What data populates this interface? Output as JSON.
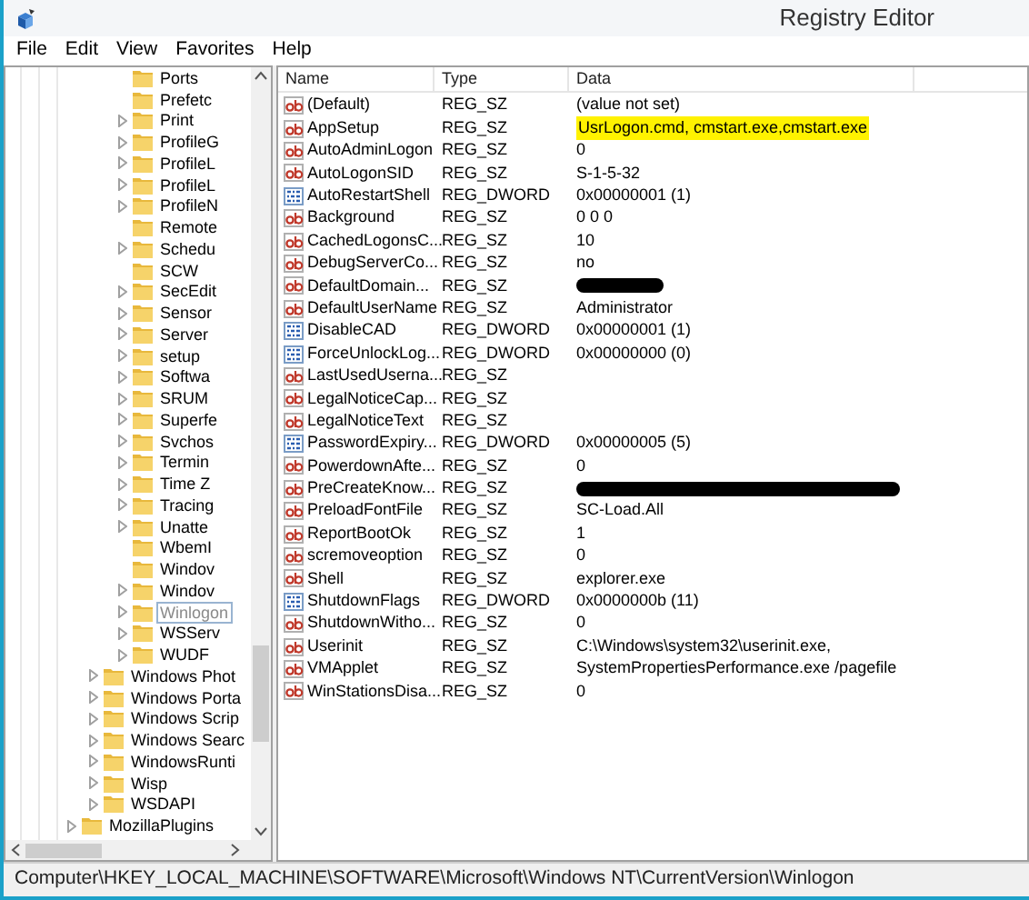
{
  "window": {
    "title": "Registry Editor"
  },
  "menu": [
    "File",
    "Edit",
    "View",
    "Favorites",
    "Help"
  ],
  "tree": {
    "items": [
      {
        "children": [
          {
            "children": [
              {
                "label": "Ports",
                "expandable": false,
                "selected": false
              },
              {
                "label": "Prefetc",
                "expandable": false,
                "selected": false
              },
              {
                "label": "Print",
                "expandable": true,
                "selected": false
              },
              {
                "label": "ProfileG",
                "expandable": true,
                "selected": false
              },
              {
                "label": "ProfileL",
                "expandable": true,
                "selected": false
              },
              {
                "label": "ProfileL",
                "expandable": true,
                "selected": false
              },
              {
                "label": "ProfileN",
                "expandable": true,
                "selected": false
              },
              {
                "label": "Remote",
                "expandable": false,
                "selected": false
              },
              {
                "label": "Schedu",
                "expandable": true,
                "selected": false
              },
              {
                "label": "SCW",
                "expandable": false,
                "selected": false
              },
              {
                "label": "SecEdit",
                "expandable": true,
                "selected": false
              },
              {
                "label": "Sensor",
                "expandable": true,
                "selected": false
              },
              {
                "label": "Server",
                "expandable": true,
                "selected": false
              },
              {
                "label": "setup",
                "expandable": true,
                "selected": false
              },
              {
                "label": "Softwa",
                "expandable": true,
                "selected": false
              },
              {
                "label": "SRUM",
                "expandable": true,
                "selected": false
              },
              {
                "label": "Superfe",
                "expandable": true,
                "selected": false
              },
              {
                "label": "Svchos",
                "expandable": true,
                "selected": false
              },
              {
                "label": "Termin",
                "expandable": true,
                "selected": false
              },
              {
                "label": "Time Z",
                "expandable": true,
                "selected": false
              },
              {
                "label": "Tracing",
                "expandable": true,
                "selected": false
              },
              {
                "label": "Unatte",
                "expandable": true,
                "selected": false
              },
              {
                "label": "WbemI",
                "expandable": false,
                "selected": false
              },
              {
                "label": "Windov",
                "expandable": false,
                "selected": false
              },
              {
                "label": "Windov",
                "expandable": true,
                "selected": false
              },
              {
                "label": "Winlogon",
                "expandable": true,
                "selected": true
              },
              {
                "label": "WSServ",
                "expandable": true,
                "selected": false
              },
              {
                "label": "WUDF",
                "expandable": true,
                "selected": false
              }
            ]
          },
          {
            "label": "Windows Phot",
            "expandable": true,
            "selected": false
          },
          {
            "label": "Windows Porta",
            "expandable": true,
            "selected": false
          },
          {
            "label": "Windows Scrip",
            "expandable": true,
            "selected": false
          },
          {
            "label": "Windows Searc",
            "expandable": true,
            "selected": false
          },
          {
            "label": "WindowsRunti",
            "expandable": true,
            "selected": false
          },
          {
            "label": "Wisp",
            "expandable": true,
            "selected": false
          },
          {
            "label": "WSDAPI",
            "expandable": true,
            "selected": false
          }
        ]
      },
      {
        "label": "MozillaPlugins",
        "expandable": true,
        "selected": false
      }
    ]
  },
  "table": {
    "columns": [
      "Name",
      "Type",
      "Data"
    ],
    "rows": [
      {
        "kind": "string",
        "name": "(Default)",
        "type": "REG_SZ",
        "data": "(value not set)"
      },
      {
        "kind": "string",
        "name": "AppSetup",
        "type": "REG_SZ",
        "data": "UsrLogon.cmd, cmstart.exe,cmstart.exe",
        "highlighted": true
      },
      {
        "kind": "string",
        "name": "AutoAdminLogon",
        "type": "REG_SZ",
        "data": "0"
      },
      {
        "kind": "string",
        "name": "AutoLogonSID",
        "type": "REG_SZ",
        "data": "S-1-5-32"
      },
      {
        "kind": "binary",
        "name": "AutoRestartShell",
        "type": "REG_DWORD",
        "data": "0x00000001 (1)"
      },
      {
        "kind": "string",
        "name": "Background",
        "type": "REG_SZ",
        "data": "0 0 0"
      },
      {
        "kind": "string",
        "name": "CachedLogonsC...",
        "type": "REG_SZ",
        "data": "10"
      },
      {
        "kind": "string",
        "name": "DebugServerCo...",
        "type": "REG_SZ",
        "data": "no"
      },
      {
        "kind": "string",
        "name": "DefaultDomain...",
        "type": "REG_SZ",
        "redacted": true
      },
      {
        "kind": "string",
        "name": "DefaultUserName",
        "type": "REG_SZ",
        "data": "Administrator"
      },
      {
        "kind": "binary",
        "name": "DisableCAD",
        "type": "REG_DWORD",
        "data": "0x00000001 (1)"
      },
      {
        "kind": "binary",
        "name": "ForceUnlockLog...",
        "type": "REG_DWORD",
        "data": "0x00000000 (0)"
      },
      {
        "kind": "string",
        "name": "LastUsedUserna...",
        "type": "REG_SZ"
      },
      {
        "kind": "string",
        "name": "LegalNoticeCap...",
        "type": "REG_SZ"
      },
      {
        "kind": "string",
        "name": "LegalNoticeText",
        "type": "REG_SZ"
      },
      {
        "kind": "binary",
        "name": "PasswordExpiry...",
        "type": "REG_DWORD",
        "data": "0x00000005 (5)"
      },
      {
        "kind": "string",
        "name": "PowerdownAfte...",
        "type": "REG_SZ",
        "data": "0"
      },
      {
        "kind": "string",
        "name": "PreCreateKnow...",
        "type": "REG_SZ",
        "redacted": true
      },
      {
        "kind": "string",
        "name": "PreloadFontFile",
        "type": "REG_SZ",
        "data": "SC-Load.All"
      },
      {
        "kind": "string",
        "name": "ReportBootOk",
        "type": "REG_SZ",
        "data": "1"
      },
      {
        "kind": "string",
        "name": "scremoveoption",
        "type": "REG_SZ",
        "data": "0"
      },
      {
        "kind": "string",
        "name": "Shell",
        "type": "REG_SZ",
        "data": "explorer.exe"
      },
      {
        "kind": "binary",
        "name": "ShutdownFlags",
        "type": "REG_DWORD",
        "data": "0x0000000b (11)"
      },
      {
        "kind": "string",
        "name": "ShutdownWitho...",
        "type": "REG_SZ",
        "data": "0"
      },
      {
        "kind": "string",
        "name": "Userinit",
        "type": "REG_SZ",
        "data": "C:\\Windows\\system32\\userinit.exe,"
      },
      {
        "kind": "string",
        "name": "VMApplet",
        "type": "REG_SZ",
        "data": "SystemPropertiesPerformance.exe /pagefile"
      },
      {
        "kind": "string",
        "name": "WinStationsDisa...",
        "type": "REG_SZ",
        "data": "0"
      }
    ]
  },
  "status_bar": "Computer\\HKEY_LOCAL_MACHINE\\SOFTWARE\\Microsoft\\Windows NT\\CurrentVersion\\Winlogon"
}
